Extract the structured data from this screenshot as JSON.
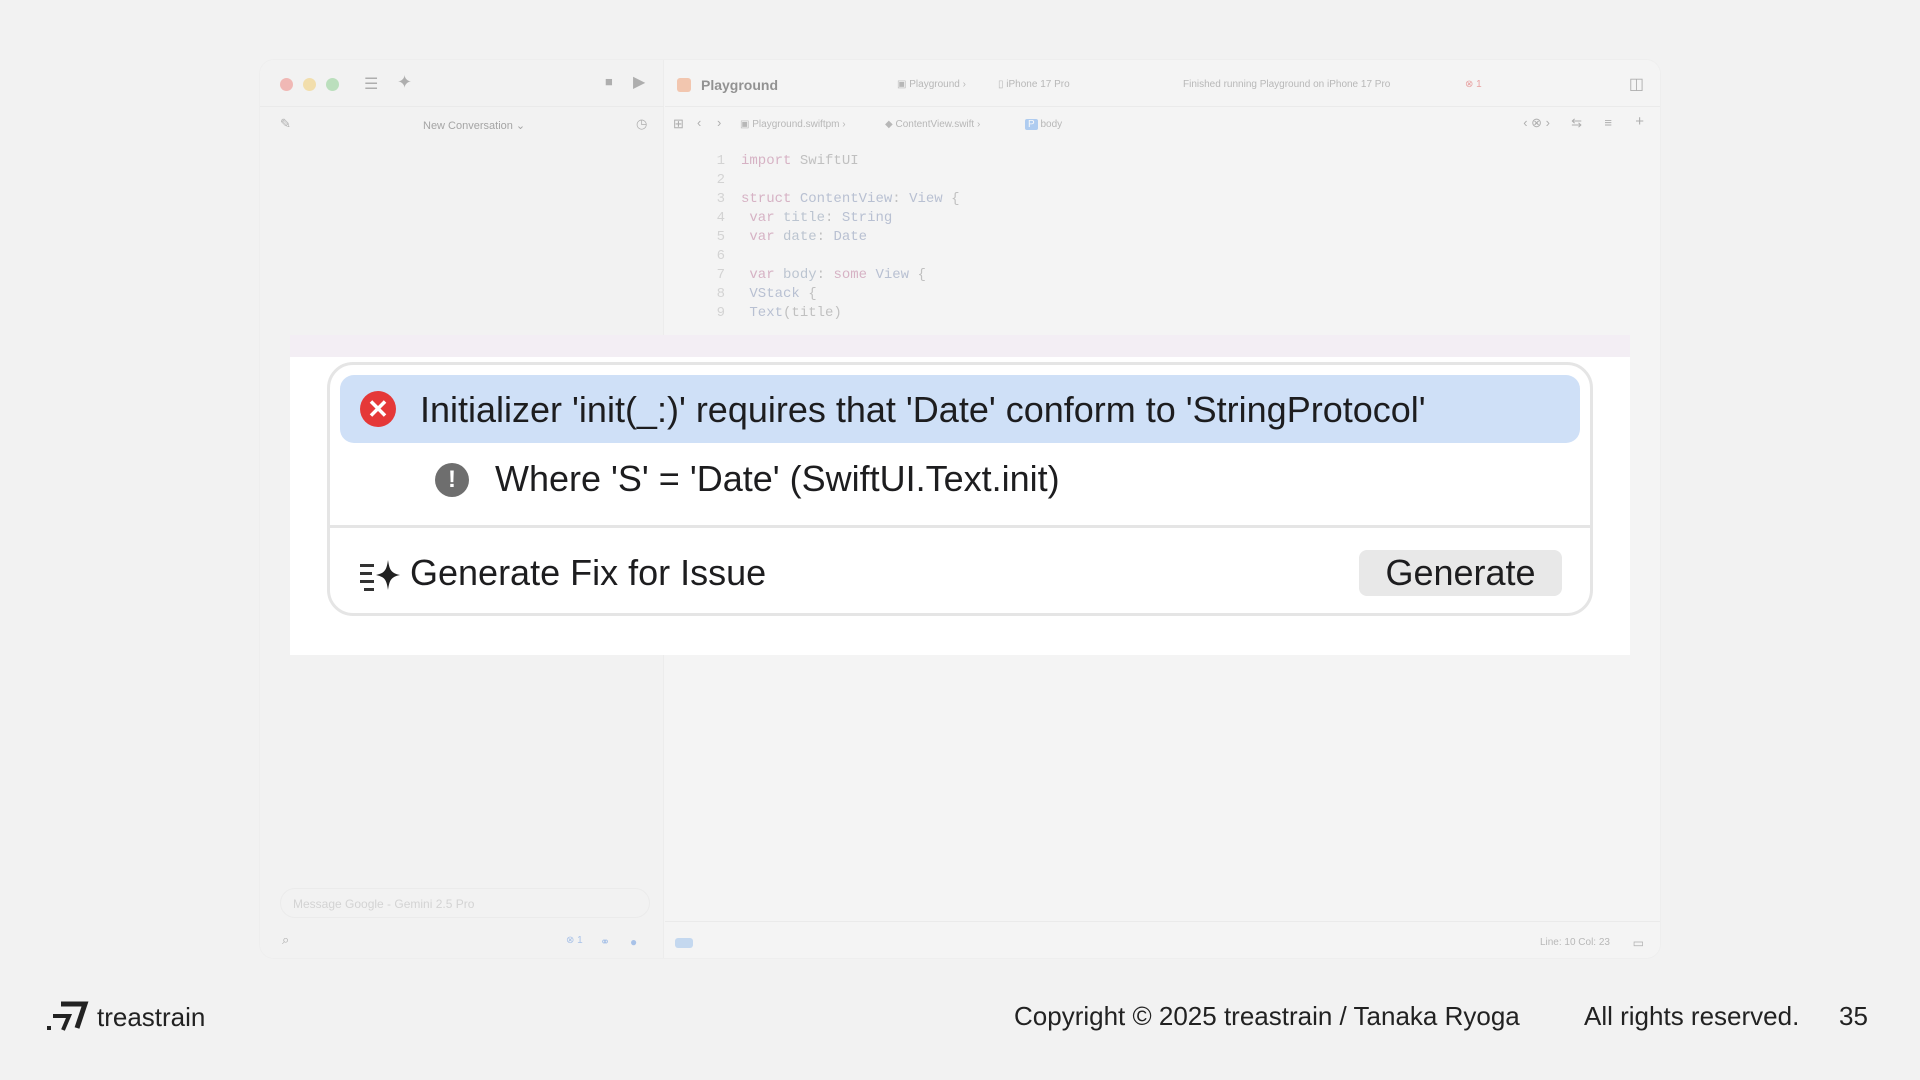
{
  "xcode": {
    "left_pane": {
      "new_conversation_label": "New Conversation ⌄",
      "message_placeholder": "Message Google - Gemini 2.5 Pro",
      "issue_count": "1"
    },
    "toolbar": {
      "scheme_title": "Playground",
      "destination_project": "Playground",
      "destination_device": "iPhone 17 Pro",
      "run_status": "Finished running Playground on iPhone 17 Pro",
      "error_count": "1"
    },
    "jump_bar": {
      "package": "Playground.swiftpm",
      "file": "ContentView.swift",
      "symbol": "body"
    },
    "code_lines": [
      {
        "n": "1",
        "text": "import SwiftUI"
      },
      {
        "n": "2",
        "text": ""
      },
      {
        "n": "3",
        "text": "struct ContentView: View {"
      },
      {
        "n": "4",
        "text": "    var title: String"
      },
      {
        "n": "5",
        "text": "    var date: Date"
      },
      {
        "n": "6",
        "text": ""
      },
      {
        "n": "7",
        "text": "    var body: some View {"
      },
      {
        "n": "8",
        "text": "        VStack {"
      },
      {
        "n": "9",
        "text": "            Text(title)"
      }
    ],
    "status_bar": {
      "cursor_position": "Line: 10  Col: 23"
    }
  },
  "issue_popover": {
    "error_message": "Initializer 'init(_:)' requires that 'Date' conform to 'StringProtocol'",
    "note_message": "Where 'S' = 'Date' (SwiftUI.Text.init)",
    "fix_label": "Generate Fix for Issue",
    "generate_button": "Generate",
    "icons": {
      "error": "error-x-circle-icon",
      "note": "exclamation-circle-icon",
      "fix": "sparkle-list-icon"
    },
    "colors": {
      "highlight": "#cfe0f7",
      "error": "#e53838"
    }
  },
  "footer": {
    "brand": "treastrain",
    "copyright": "Copyright © 2025 treastrain / Tanaka Ryoga",
    "rights": "All rights reserved.",
    "page_number": "35"
  }
}
